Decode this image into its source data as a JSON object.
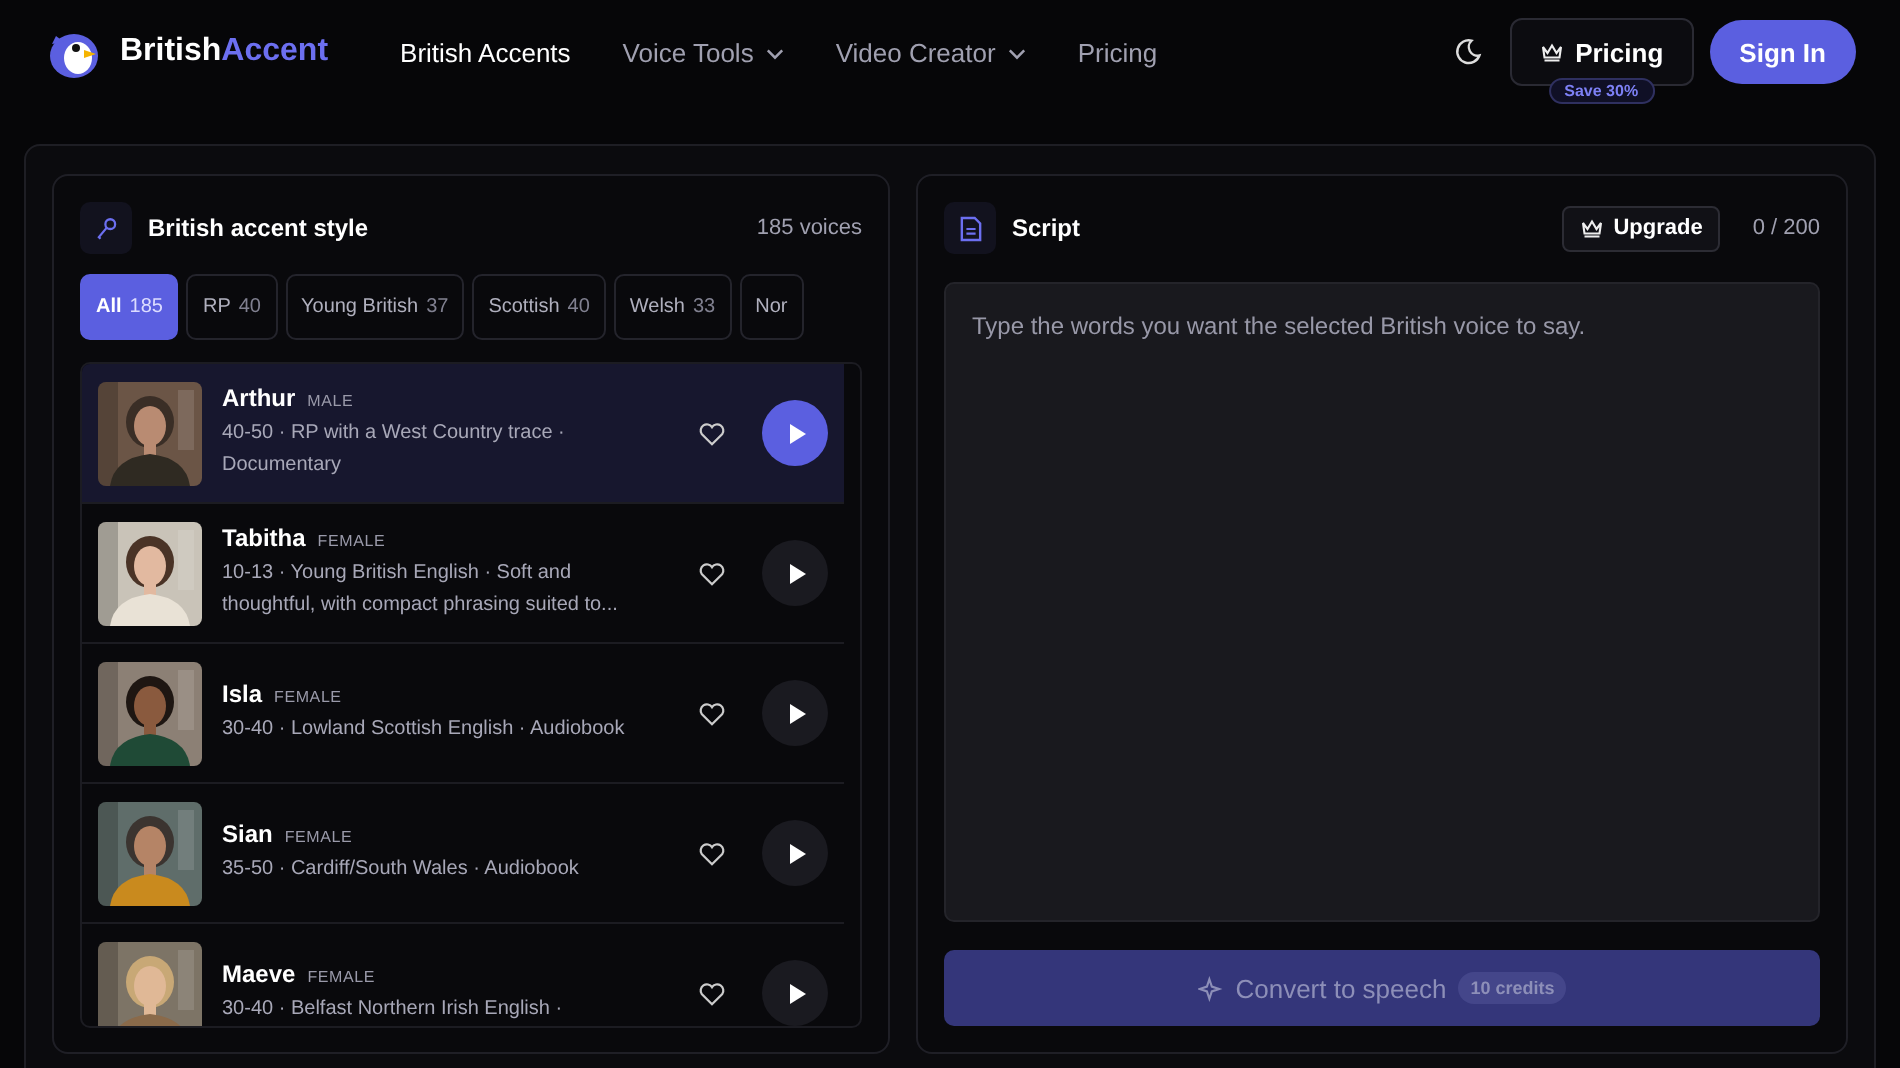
{
  "header": {
    "logo": {
      "first": "British",
      "second": "Accent"
    },
    "nav": [
      {
        "label": "British Accents",
        "selected": true,
        "dropdown": false
      },
      {
        "label": "Voice Tools",
        "selected": false,
        "dropdown": true
      },
      {
        "label": "Video Creator",
        "selected": false,
        "dropdown": true
      },
      {
        "label": "Pricing",
        "selected": false,
        "dropdown": false
      }
    ],
    "pricing_button": "Pricing",
    "pricing_badge": "Save 30%",
    "sign_in": "Sign In"
  },
  "accent_panel": {
    "title": "British accent style",
    "count": "185 voices",
    "filters": [
      {
        "label": "All",
        "count": "185",
        "selected": true
      },
      {
        "label": "RP",
        "count": "40",
        "selected": false
      },
      {
        "label": "Young British",
        "count": "37",
        "selected": false
      },
      {
        "label": "Scottish",
        "count": "40",
        "selected": false
      },
      {
        "label": "Welsh",
        "count": "33",
        "selected": false
      },
      {
        "label": "Nor",
        "selected": false
      }
    ],
    "voices": [
      {
        "name": "Arthur",
        "gender": "MALE",
        "description": "40-50 · RP with a West Country trace · Documentary",
        "selected": true
      },
      {
        "name": "Tabitha",
        "gender": "FEMALE",
        "description": "10-13 · Young British English · Soft and thoughtful, with compact phrasing suited to...",
        "selected": false
      },
      {
        "name": "Isla",
        "gender": "FEMALE",
        "description": "30-40 · Lowland Scottish English · Audiobook",
        "selected": false
      },
      {
        "name": "Sian",
        "gender": "FEMALE",
        "description": "35-50 · Cardiff/South Wales · Audiobook",
        "selected": false
      },
      {
        "name": "Maeve",
        "gender": "FEMALE",
        "description": "30-40 · Belfast Northern Irish English ·",
        "selected": false
      }
    ]
  },
  "script_panel": {
    "title": "Script",
    "upgrade": "Upgrade",
    "counter": "0 / 200",
    "placeholder": "Type the words you want the selected British voice to say.",
    "convert": {
      "label": "Convert to speech",
      "credits": "10 credits",
      "disabled": true
    }
  }
}
